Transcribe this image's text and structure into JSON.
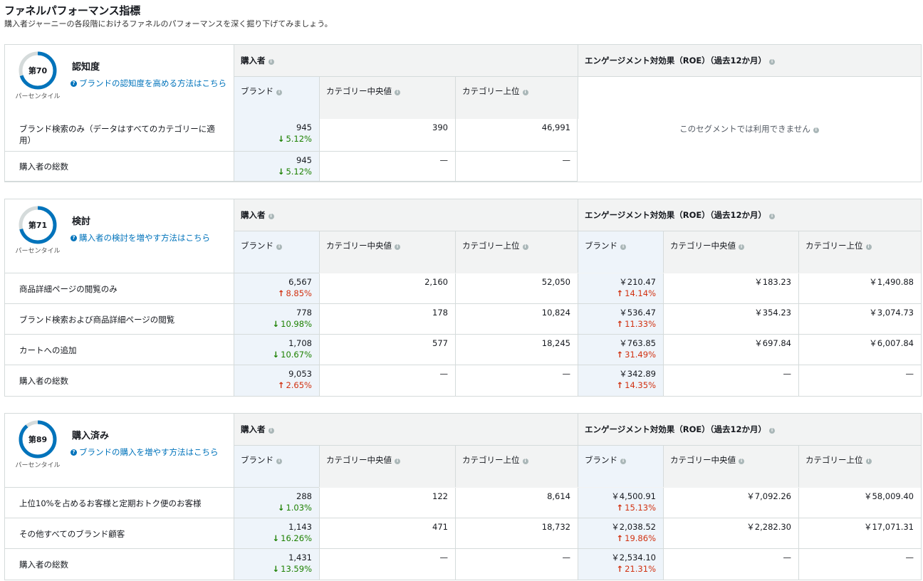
{
  "header": {
    "title": "ファネルパフォーマンス指標",
    "subtitle": "購入者ジャーニーの各段階におけるファネルのパフォーマンスを深く掘り下げてみましょう。"
  },
  "colors": {
    "ring": "#0073bb",
    "ring_track": "#d5dbdb",
    "up": "#d13212",
    "down": "#1d8102",
    "link": "#0073bb"
  },
  "labels": {
    "buyers": "購入者",
    "roe": "エンゲージメント対効果（ROE）（過去12か月）",
    "brand": "ブランド",
    "cat_median": "カテゴリー中央値",
    "cat_top": "カテゴリー上位",
    "percentile": "パーセンタイル",
    "not_available": "このセグメントでは利用できません",
    "dash": "—"
  },
  "sections": [
    {
      "rank": "第70",
      "percentile": 0.7,
      "name": "認知度",
      "link": "ブランドの認知度を高める方法はこちら",
      "rows": [
        {
          "label": "ブランド検索のみ（データはすべてのカテゴリーに適用）",
          "brand": "945",
          "dir": "down",
          "delta": "5.12%",
          "median": "390",
          "top": "46,991"
        },
        {
          "label": "購入者の総数",
          "brand": "945",
          "dir": "down",
          "delta": "5.12%",
          "median": "—",
          "top": "—"
        }
      ]
    },
    {
      "rank": "第71",
      "percentile": 0.71,
      "name": "検討",
      "link": "購入者の検討を増やす方法はこちら",
      "rows": [
        {
          "label": "商品詳細ページの閲覧のみ",
          "brand": "6,567",
          "dir": "up",
          "delta": "8.85%",
          "median": "2,160",
          "top": "52,050",
          "roe_brand": "￥210.47",
          "roe_dir": "up",
          "roe_delta": "14.14%",
          "roe_median": "￥183.23",
          "roe_top": "￥1,490.88"
        },
        {
          "label": "ブランド検索および商品詳細ページの閲覧",
          "brand": "778",
          "dir": "down",
          "delta": "10.98%",
          "median": "178",
          "top": "10,824",
          "roe_brand": "￥536.47",
          "roe_dir": "up",
          "roe_delta": "11.33%",
          "roe_median": "￥354.23",
          "roe_top": "￥3,074.73"
        },
        {
          "label": "カートへの追加",
          "brand": "1,708",
          "dir": "down",
          "delta": "10.67%",
          "median": "577",
          "top": "18,245",
          "roe_brand": "￥763.85",
          "roe_dir": "up",
          "roe_delta": "31.49%",
          "roe_median": "￥697.84",
          "roe_top": "￥6,007.84"
        },
        {
          "label": "購入者の総数",
          "brand": "9,053",
          "dir": "up",
          "delta": "2.65%",
          "median": "—",
          "top": "—",
          "roe_brand": "￥342.89",
          "roe_dir": "up",
          "roe_delta": "14.35%",
          "roe_median": "—",
          "roe_top": "—"
        }
      ]
    },
    {
      "rank": "第89",
      "percentile": 0.89,
      "name": "購入済み",
      "link": "ブランドの購入を増やす方法はこちら",
      "rows": [
        {
          "label": "上位10%を占めるお客様と定期おトク便のお客様",
          "brand": "288",
          "dir": "down",
          "delta": "1.03%",
          "median": "122",
          "top": "8,614",
          "roe_brand": "￥4,500.91",
          "roe_dir": "up",
          "roe_delta": "15.13%",
          "roe_median": "￥7,092.26",
          "roe_top": "￥58,009.40"
        },
        {
          "label": "その他すべてのブランド顧客",
          "brand": "1,143",
          "dir": "down",
          "delta": "16.26%",
          "median": "471",
          "top": "18,732",
          "roe_brand": "￥2,038.52",
          "roe_dir": "up",
          "roe_delta": "19.86%",
          "roe_median": "￥2,282.30",
          "roe_top": "￥17,071.31"
        },
        {
          "label": "購入者の総数",
          "brand": "1,431",
          "dir": "down",
          "delta": "13.59%",
          "median": "—",
          "top": "—",
          "roe_brand": "￥2,534.10",
          "roe_dir": "up",
          "roe_delta": "21.31%",
          "roe_median": "—",
          "roe_top": "—"
        }
      ]
    }
  ]
}
